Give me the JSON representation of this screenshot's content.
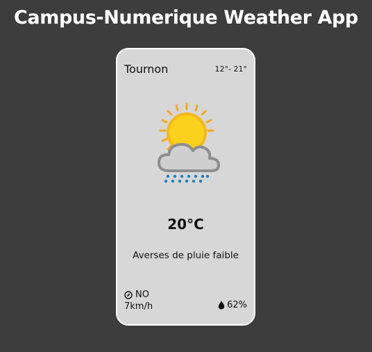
{
  "app": {
    "title": "Campus-Numerique Weather App"
  },
  "weather": {
    "city": "Tournon",
    "temp_range": "12°- 21°",
    "icon": "sun-behind-rain-cloud-icon",
    "temperature": "20°C",
    "description": "Averses de pluie faible",
    "wind_direction": "NO",
    "wind_direction_icon": "compass-icon",
    "wind_speed": "7km/h",
    "humidity": "62%",
    "humidity_icon": "droplet-icon"
  },
  "colors": {
    "background": "#3d3d3d",
    "card": "#d7d7d7",
    "sun": "#fcd11d",
    "sun_rays": "#f7a81b",
    "cloud": "#c8c8c8",
    "rain": "#1e7fc2"
  }
}
